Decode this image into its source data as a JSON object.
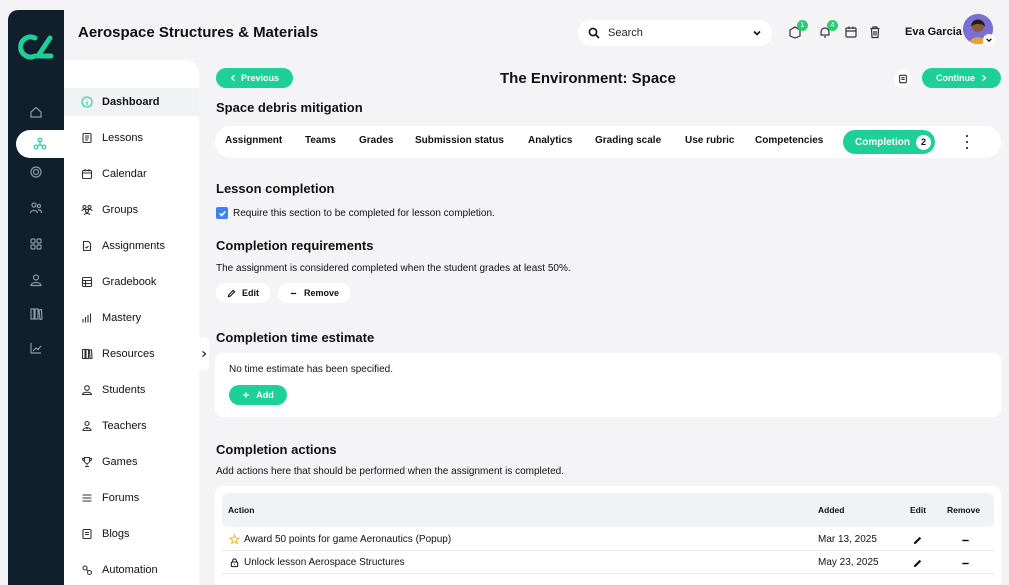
{
  "header": {
    "app_title": "Aerospace Structures & Materials",
    "search_placeholder": "Search",
    "notifications": [
      {
        "icon": "tasks-icon",
        "badge": "1"
      },
      {
        "icon": "bell-icon",
        "badge": "4"
      },
      {
        "icon": "calendar-icon"
      },
      {
        "icon": "trash-icon"
      }
    ],
    "user_name": "Eva Garcia"
  },
  "sidebar": {
    "items": [
      {
        "label": "Dashboard",
        "icon": "info-icon",
        "active": true
      },
      {
        "label": "Lessons",
        "icon": "lessons-icon"
      },
      {
        "label": "Calendar",
        "icon": "calendar-icon"
      },
      {
        "label": "Groups",
        "icon": "groups-icon"
      },
      {
        "label": "Assignments",
        "icon": "assignment-icon"
      },
      {
        "label": "Gradebook",
        "icon": "gradebook-icon"
      },
      {
        "label": "Mastery",
        "icon": "mastery-icon"
      },
      {
        "label": "Resources",
        "icon": "resources-icon"
      },
      {
        "label": "Students",
        "icon": "student-icon"
      },
      {
        "label": "Teachers",
        "icon": "teacher-icon"
      },
      {
        "label": "Games",
        "icon": "trophy-icon"
      },
      {
        "label": "Forums",
        "icon": "forum-icon"
      },
      {
        "label": "Blogs",
        "icon": "blog-icon"
      },
      {
        "label": "Automation",
        "icon": "automation-icon"
      }
    ]
  },
  "page": {
    "previous_label": "Previous",
    "title": "The Environment: Space",
    "continue_label": "Continue",
    "subtitle": "Space debris mitigation",
    "tabs": [
      {
        "label": "Assignment"
      },
      {
        "label": "Teams"
      },
      {
        "label": "Grades"
      },
      {
        "label": "Submission status"
      },
      {
        "label": "Analytics"
      },
      {
        "label": "Grading scale"
      },
      {
        "label": "Use rubric"
      },
      {
        "label": "Competencies"
      },
      {
        "label": "Completion",
        "count": "2",
        "active": true
      }
    ]
  },
  "lesson_completion": {
    "heading": "Lesson completion",
    "checkbox_label": "Require this section to be completed for lesson completion.",
    "checked": true
  },
  "requirements": {
    "heading": "Completion requirements",
    "text": "The assignment is considered completed when the student grades at least 50%.",
    "edit_label": "Edit",
    "remove_label": "Remove"
  },
  "time_estimate": {
    "heading": "Completion time estimate",
    "text": "No time estimate has been specified.",
    "add_label": "Add"
  },
  "actions": {
    "heading": "Completion actions",
    "text": "Add actions here that should be performed when the assignment is completed.",
    "columns": [
      "Action",
      "Added",
      "Edit",
      "Remove"
    ],
    "rows": [
      {
        "icon": "star-icon",
        "action": "Award 50 points for game Aeronautics (Popup)",
        "added": "Mar 13, 2025"
      },
      {
        "icon": "lock-icon",
        "action": "Unlock lesson Aerospace Structures",
        "added": "May 23, 2025"
      }
    ]
  },
  "colors": {
    "accent": "#1fcf9a",
    "rail": "#0f1f2b",
    "checkbox": "#3b82f6"
  }
}
